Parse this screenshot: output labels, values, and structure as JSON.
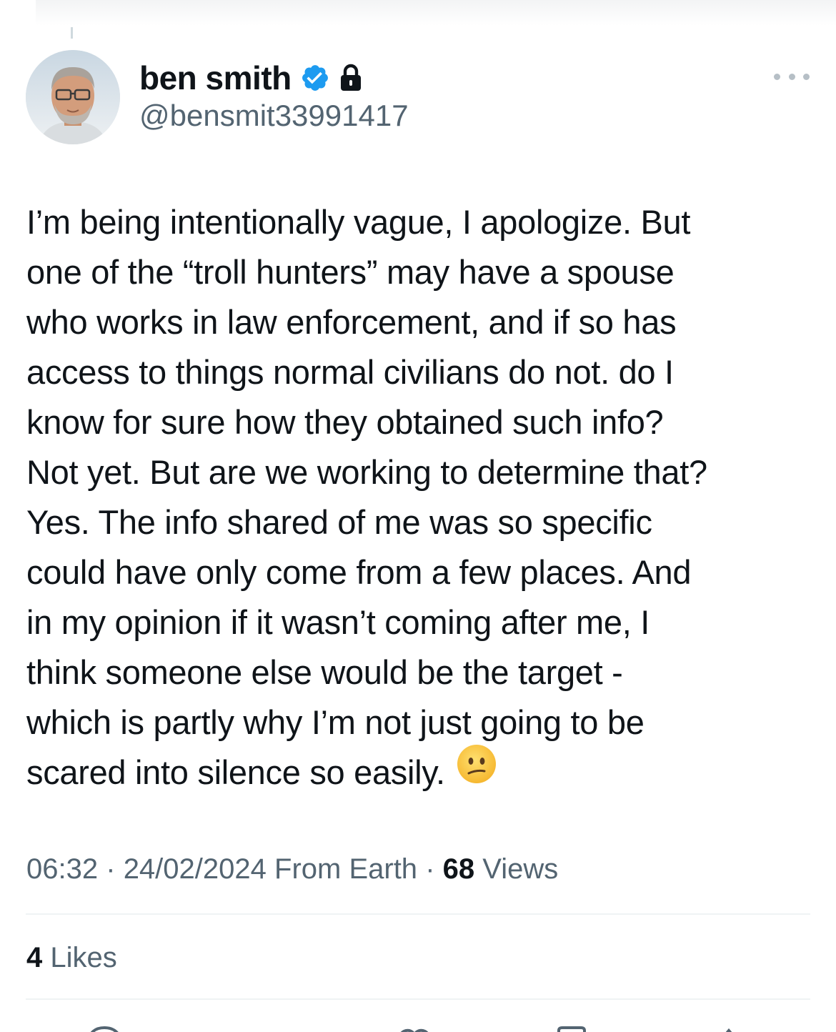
{
  "author": {
    "display_name": "ben smith",
    "handle": "@bensmit33991417",
    "verified": true,
    "protected": true
  },
  "tweet": {
    "lines": [
      "I’m being intentionally vague, I apologize. But",
      "one of the “troll hunters” may have a spouse",
      "who works in law enforcement, and if so has",
      "access to things normal civilians do not. do I",
      "know for sure how they obtained such info?",
      "Not yet. But are we working to determine that?",
      "Yes. The info shared of me was so specific",
      "could have only come from a few places. And",
      "in my opinion if it wasn’t coming after me, I",
      "think someone else would be the target -",
      "which is partly why I’m not just going to be",
      "scared into silence so easily."
    ],
    "emoji": "confused-face"
  },
  "meta": {
    "time": "06:32",
    "separator": "·",
    "date": "24/02/2024",
    "source": "From Earth",
    "views_count": "68",
    "views_label": "Views"
  },
  "engagement": {
    "likes_count": "4",
    "likes_label": "Likes"
  },
  "icons": {
    "verified_badge": "verified-badge-icon",
    "lock": "lock-icon",
    "more": "more-icon",
    "actions": [
      "reply-icon",
      "retweet-icon",
      "like-icon",
      "bookmark-icon",
      "share-icon"
    ]
  },
  "colors": {
    "verified_blue": "#1d9bf0",
    "text_primary": "#0f1419",
    "text_secondary": "#536471",
    "divider": "#eff3f4"
  }
}
